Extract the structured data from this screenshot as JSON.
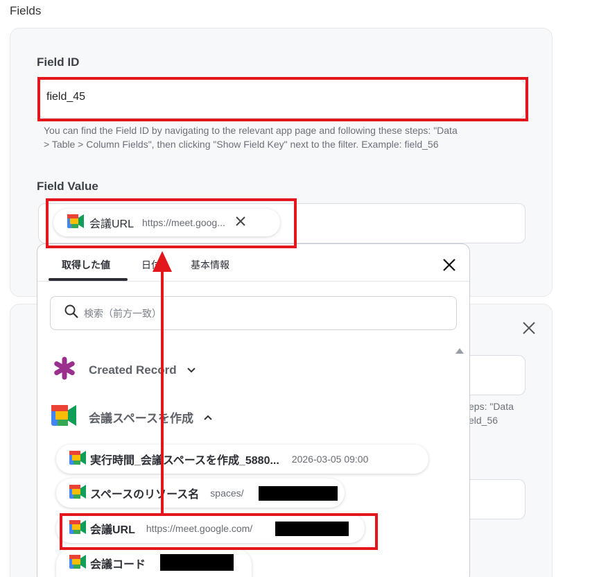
{
  "section": {
    "title": "Fields"
  },
  "field_id": {
    "label": "Field ID",
    "value": "field_45",
    "help_line1": "You can find the Field ID by navigating to the relevant app page and following these steps: \"Data",
    "help_line2": "> Table > Column Fields\", then clicking \"Show Field Key\" next to the filter. Example: field_56"
  },
  "field_value": {
    "label": "Field Value",
    "chip_label": "会議URL",
    "chip_value": "https://meet.goog..."
  },
  "card2_partial": {
    "help_line1": "eps: \"Data",
    "help_line2": "eld_56"
  },
  "popup": {
    "tabs": [
      "取得した値",
      "日付",
      "基本情報"
    ],
    "active_tab": "取得した値",
    "search_placeholder": "検索（前方一致）",
    "groups": [
      {
        "name": "Created Record",
        "expanded": false
      },
      {
        "name": "会議スペースを作成",
        "expanded": true
      }
    ],
    "items": [
      {
        "label": "実行時間_会議スペースを作成_5880...",
        "value": "2026-03-05 09:00"
      },
      {
        "label": "スペースのリソース名",
        "value": "spaces/"
      },
      {
        "label": "会議URL",
        "value": "https://meet.google.com/"
      },
      {
        "label": "会議コード",
        "value": ""
      }
    ]
  },
  "colors": {
    "highlight": "#e3161b",
    "redaction": "#000000",
    "accent_purple": "#9b2f8e"
  }
}
